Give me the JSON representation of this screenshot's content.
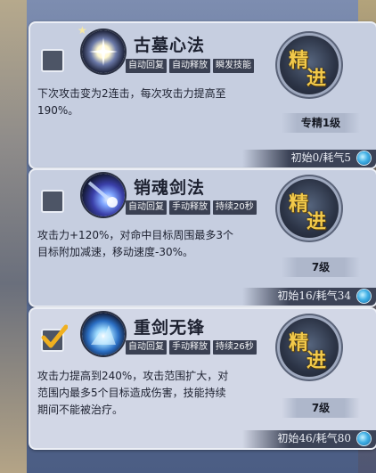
{
  "skills": [
    {
      "name": "古墓心法",
      "checked": false,
      "tags": [
        "自动回复",
        "自动释放",
        "瞬发技能"
      ],
      "desc_line1": "下次攻击变为2连击，每次攻击力提高至",
      "desc_line2": "190%。",
      "desc_line3": "",
      "upgrade_char1": "精",
      "upgrade_char2": "进",
      "level": "专精1级",
      "cost": "初始0/耗气5"
    },
    {
      "name": "销魂剑法",
      "checked": false,
      "tags": [
        "自动回复",
        "手动释放",
        "持续20秒"
      ],
      "desc_line1": "攻击力+120%，对命中目标周围最多3个",
      "desc_line2": "目标附加减速，移动速度-30%。",
      "desc_line3": "",
      "upgrade_char1": "精",
      "upgrade_char2": "进",
      "level": "7级",
      "cost": "初始16/耗气34"
    },
    {
      "name": "重剑无锋",
      "checked": true,
      "tags": [
        "自动回复",
        "手动释放",
        "持续26秒"
      ],
      "desc_line1": "攻击力提高到240%，攻击范围扩大，对",
      "desc_line2": "范围内最多5个目标造成伤害，技能持续",
      "desc_line3": "期间不能被治疗。",
      "upgrade_char1": "精",
      "upgrade_char2": "进",
      "level": "7级",
      "cost": "初始46/耗气80"
    }
  ],
  "colors": {
    "card_bg": "#c6cee0",
    "tag_bg": "#3a4052",
    "upgrade_text": "#f2c94a",
    "check_mark": "#f0b020"
  },
  "icons": {
    "skill1": "sparkle-orb-icon",
    "skill2": "comet-sword-icon",
    "skill3": "blue-blast-icon",
    "qi": "qi-orb-icon",
    "check": "checkmark-icon"
  }
}
